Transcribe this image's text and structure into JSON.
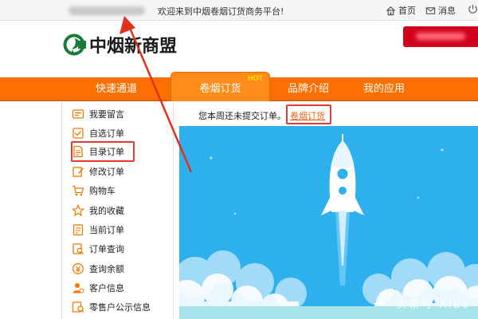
{
  "topbar": {
    "welcome": "欢迎来到中烟卷烟订货商务平台!",
    "home_label": "首页",
    "message_label": "消息"
  },
  "header": {
    "logo_text": "中烟新商盟"
  },
  "nav": {
    "items": [
      {
        "label": "快速通道"
      },
      {
        "label": "卷烟订货",
        "badge": "HOT",
        "active": true
      },
      {
        "label": "品牌介绍"
      },
      {
        "label": "我的应用"
      }
    ]
  },
  "sidebar": {
    "items": [
      {
        "label": "我要留言",
        "icon": "message-icon"
      },
      {
        "label": "自选订单",
        "icon": "checklist-icon"
      },
      {
        "label": "目录订单",
        "icon": "document-icon",
        "highlighted": true
      },
      {
        "label": "修改订单",
        "icon": "edit-icon"
      },
      {
        "label": "购物车",
        "icon": "cart-icon"
      },
      {
        "label": "我的收藏",
        "icon": "star-icon"
      },
      {
        "label": "当前订单",
        "icon": "order-icon"
      },
      {
        "label": "订单查询",
        "icon": "query-icon"
      },
      {
        "label": "查询余额",
        "icon": "balance-icon"
      },
      {
        "label": "客户信息",
        "icon": "user-icon"
      },
      {
        "label": "零售户公示信息",
        "icon": "notice-icon"
      }
    ]
  },
  "main": {
    "notice_text": "您本周还未提交订单。",
    "notice_link": "卷烟订货"
  },
  "watermark": "头条号 Xiao",
  "colors": {
    "nav_orange": "#fd7000",
    "highlight_red": "#e03a3a",
    "hero_blue": "#2fb1ef",
    "link_orange": "#e8601c"
  }
}
